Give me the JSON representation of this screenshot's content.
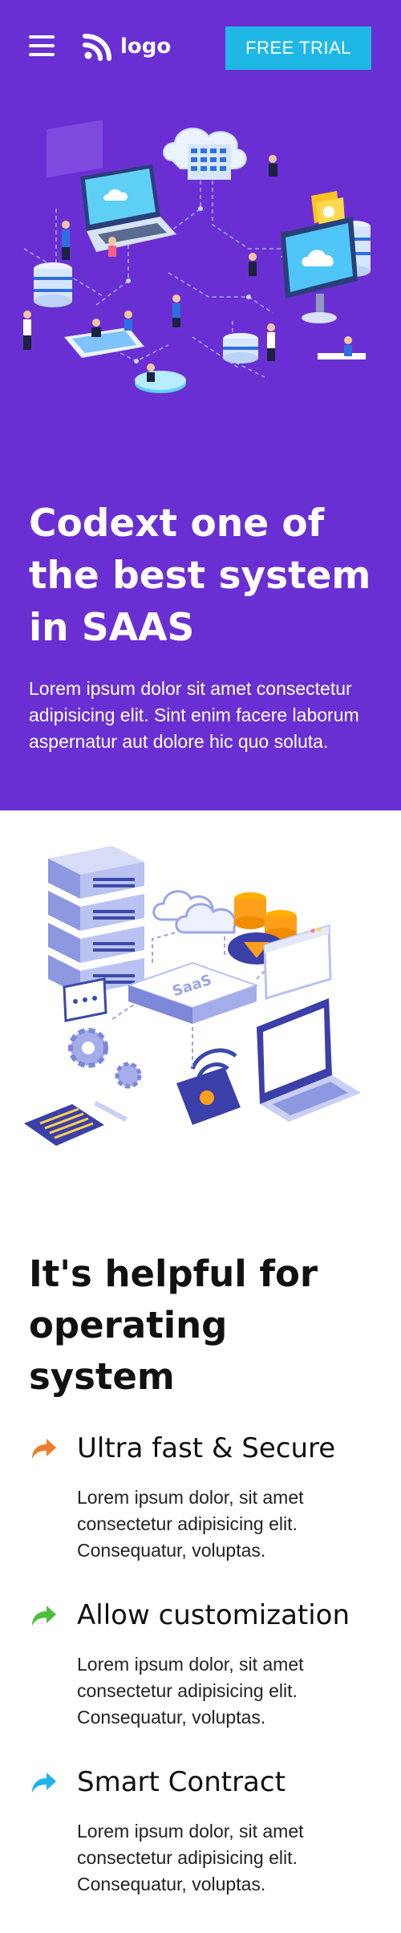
{
  "header": {
    "menu_icon": "hamburger-menu-icon",
    "logo_icon": "rss-logo-icon",
    "logo_text": "logo",
    "cta_label": "FREE TRIAL"
  },
  "hero": {
    "title": "Codext one of the best system in SAAS",
    "description": "Lorem ipsum dolor sit amet consectetur adipisicing elit. Sint enim facere laborum aspernatur aut dolore hic quo soluta."
  },
  "saas_illustration": {
    "badge_text": "SaaS"
  },
  "section": {
    "title": "It's helpful for operating system"
  },
  "features": [
    {
      "title": "Ultra fast & Secure",
      "description": "Lorem ipsum dolor, sit amet consectetur adipisicing elit. Consequatur, voluptas.",
      "icon": "share-arrow-icon",
      "icon_color": "#f07c2a"
    },
    {
      "title": "Allow customization",
      "description": "Lorem ipsum dolor, sit amet consectetur adipisicing elit. Consequatur, voluptas.",
      "icon": "share-arrow-icon",
      "icon_color": "#4cbf3b"
    },
    {
      "title": "Smart Contract",
      "description": "Lorem ipsum dolor, sit amet consectetur adipisicing elit. Consequatur, voluptas.",
      "icon": "share-arrow-icon",
      "icon_color": "#1fb3ea"
    }
  ],
  "colors": {
    "hero_bg": "#6a2fd3",
    "cta_bg": "#1fb8e6"
  }
}
